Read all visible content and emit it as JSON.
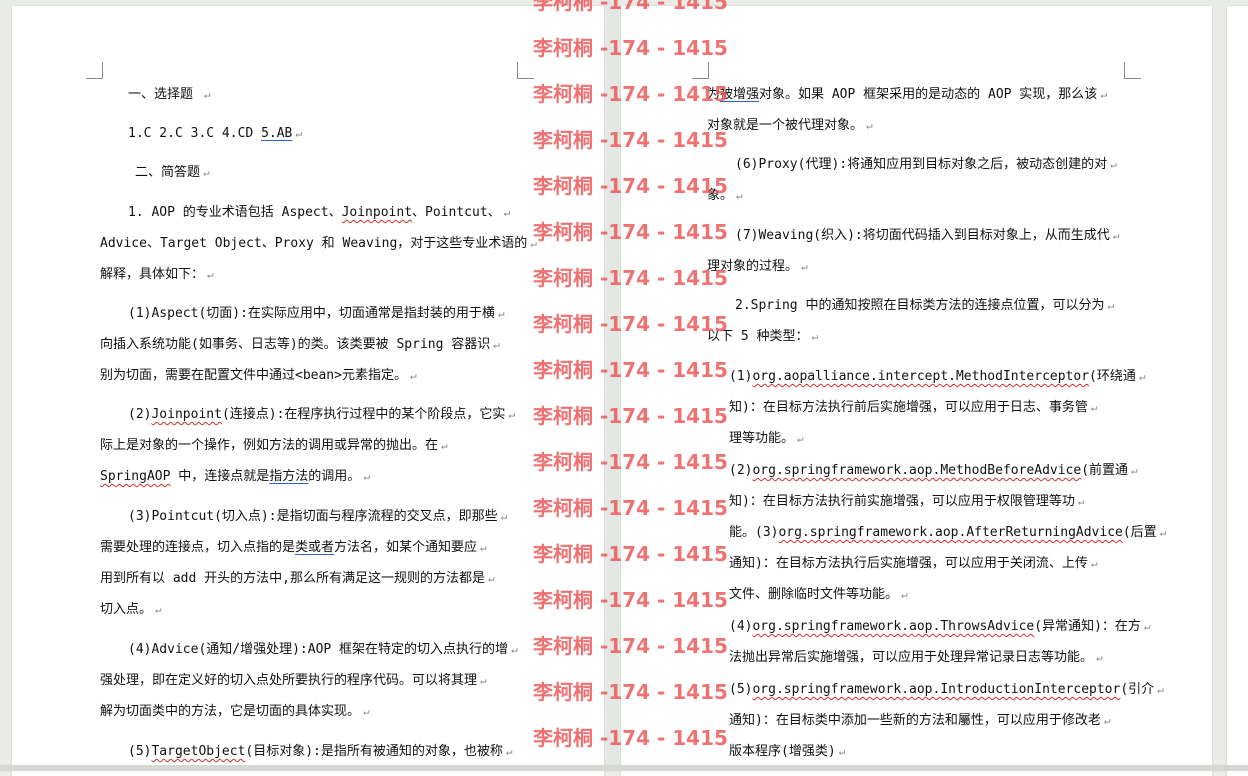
{
  "left_page": {
    "lines": [
      {
        "indent": 28,
        "segments": [
          {
            "t": "一、选择题 "
          }
        ]
      },
      {
        "indent": 28,
        "segments": [
          {
            "t": "1.C 2.C 3.C 4.CD "
          },
          {
            "t": "5.AB",
            "style": "blueline"
          }
        ]
      },
      {
        "indent": 35,
        "segments": [
          {
            "t": "二、简答题"
          }
        ]
      },
      {
        "indent": 28,
        "segments": [
          {
            "t": "1. AOP 的专业术语包括 Aspect、"
          },
          {
            "t": "Joinpoint",
            "style": "wavy"
          },
          {
            "t": "、Pointcut、"
          }
        ]
      },
      {
        "indent": 0,
        "segments": [
          {
            "t": "Advice、Target Object、Proxy 和 Weaving，对于这些专业术语的"
          }
        ]
      },
      {
        "indent": 0,
        "segments": [
          {
            "t": "解释，具体如下："
          }
        ]
      },
      {
        "indent": 28,
        "segments": [
          {
            "t": "(1)Aspect(切面):在实际应用中，切面通常是指封装的用于横"
          }
        ]
      },
      {
        "indent": 0,
        "segments": [
          {
            "t": "向插入系统功能(如事务、日志等)的类。该类要被 Spring 容器识"
          }
        ]
      },
      {
        "indent": 0,
        "segments": [
          {
            "t": "别为切面，需要在配置文件中通过<bean>元素指定。"
          }
        ]
      },
      {
        "indent": 28,
        "segments": [
          {
            "t": "(2)"
          },
          {
            "t": "Joinpoint",
            "style": "wavy"
          },
          {
            "t": "(连接点):在程序执行过程中的某个阶段点，它实"
          }
        ]
      },
      {
        "indent": 0,
        "segments": [
          {
            "t": "际上是对象的一个操作，例如方法的调用或异常的抛出。在"
          }
        ]
      },
      {
        "indent": 0,
        "segments": [
          {
            "t": "SpringAOP",
            "style": "wavy"
          },
          {
            "t": " 中，连接点就是"
          },
          {
            "t": "指方法",
            "style": "blueline"
          },
          {
            "t": "的调用。"
          }
        ]
      },
      {
        "indent": 28,
        "segments": [
          {
            "t": "(3)Pointcut(切入点):是指切面与程序流程的交叉点，即那些"
          }
        ]
      },
      {
        "indent": 0,
        "segments": [
          {
            "t": "需要处理的连接点，切入点指的是"
          },
          {
            "t": "类或者",
            "style": "blueline"
          },
          {
            "t": "方法名，如某个通知要应"
          }
        ]
      },
      {
        "indent": 0,
        "segments": [
          {
            "t": "用到所有以 add 开头的方法中,那么所有满足这一规则的方法都是"
          }
        ]
      },
      {
        "indent": 0,
        "segments": [
          {
            "t": "切入点。"
          }
        ]
      },
      {
        "indent": 28,
        "segments": [
          {
            "t": "(4)Advice(通知/增强处理):AOP 框架在特定的切入点执行的增"
          }
        ]
      },
      {
        "indent": 0,
        "segments": [
          {
            "t": "强处理，即在定义好的切入点处所要执行的程序代码。可以将其理"
          }
        ]
      },
      {
        "indent": 0,
        "segments": [
          {
            "t": "解为切面类中的方法，它是切面的具体实现。"
          }
        ]
      },
      {
        "indent": 28,
        "segments": [
          {
            "t": "(5)"
          },
          {
            "t": "TargetObject",
            "style": "wavy"
          },
          {
            "t": "(目标对象):是指所有被通知的对象，也被称"
          }
        ]
      }
    ]
  },
  "right_page": {
    "lines": [
      {
        "indent": 0,
        "segments": [
          {
            "t": "为"
          },
          {
            "t": "被增强",
            "style": "blueline"
          },
          {
            "t": "对象。如果 AOP 框架采用的是动态的 AOP 实现，那么该"
          }
        ]
      },
      {
        "indent": 0,
        "segments": [
          {
            "t": "对象就是一个被代理对象。"
          }
        ]
      },
      {
        "indent": 28,
        "segments": [
          {
            "t": "(6)Proxy(代理):将通知应用到目标对象之后，被动态创建的对"
          }
        ]
      },
      {
        "indent": 0,
        "segments": [
          {
            "t": "象。"
          }
        ]
      },
      {
        "indent": 28,
        "segments": [
          {
            "t": "(7)Weaving(织入):将切面代码插入到目标对象上，从而生成代"
          }
        ]
      },
      {
        "indent": 0,
        "segments": [
          {
            "t": "理对象的过程。"
          }
        ]
      },
      {
        "indent": 28,
        "segments": [
          {
            "t": "2.Spring 中的通知按照在目标类方法的连接点位置，可以分为"
          }
        ]
      },
      {
        "indent": 0,
        "segments": [
          {
            "t": "以下 5 种类型："
          }
        ]
      },
      {
        "indent": 22,
        "segments": [
          {
            "t": "(1)"
          },
          {
            "t": "org.aopalliance.intercept.MethodInterceptor",
            "style": "wavy"
          },
          {
            "t": "(环绕通"
          }
        ]
      },
      {
        "indent": 22,
        "segments": [
          {
            "t": "知)：在目标方法执行前后实施增强，可以应用于日志、事务管"
          }
        ]
      },
      {
        "indent": 22,
        "segments": [
          {
            "t": "理等功能。"
          }
        ]
      },
      {
        "indent": 22,
        "segments": [
          {
            "t": "(2)"
          },
          {
            "t": "org.springframework.aop.MethodBeforeAdvice",
            "style": "wavy"
          },
          {
            "t": "(前置通"
          }
        ]
      },
      {
        "indent": 22,
        "segments": [
          {
            "t": "知)：在目标方法执行前实施增强，可以应用于权限管理等功"
          }
        ]
      },
      {
        "indent": 22,
        "segments": [
          {
            "t": "能。(3)"
          },
          {
            "t": "org.springframework.aop.AfterReturningAdvice",
            "style": "wavy"
          },
          {
            "t": "(后置"
          }
        ]
      },
      {
        "indent": 22,
        "segments": [
          {
            "t": "通知)：在目标方法执行后实施增强，可以应用于关闭流、上传"
          }
        ]
      },
      {
        "indent": 22,
        "segments": [
          {
            "t": "文件、删除临时文件等功能。"
          }
        ]
      },
      {
        "indent": 22,
        "segments": [
          {
            "t": "(4)"
          },
          {
            "t": "org.springframework.aop.ThrowsAdvice",
            "style": "wavy"
          },
          {
            "t": "(异常通知)：在方"
          }
        ]
      },
      {
        "indent": 22,
        "segments": [
          {
            "t": "法抛出异常后实施增强，可以应用于处理异常记录日志等功能。"
          }
        ]
      },
      {
        "indent": 22,
        "segments": [
          {
            "t": "(5)"
          },
          {
            "t": "org.springframework.aop.IntroductionInterceptor",
            "style": "wavy"
          },
          {
            "t": "(引介"
          }
        ]
      },
      {
        "indent": 22,
        "segments": [
          {
            "t": "通知)：在目标类中添加一些新的方法和屬性，可以应用于修改老"
          }
        ]
      },
      {
        "indent": 22,
        "segments": [
          {
            "t": "版本程序(增强类)"
          }
        ]
      }
    ]
  },
  "paragraph_mark": "↵",
  "watermark": {
    "text": "李柯桐 -174 - 1415",
    "color": "#ec5a5a",
    "count": 17
  }
}
